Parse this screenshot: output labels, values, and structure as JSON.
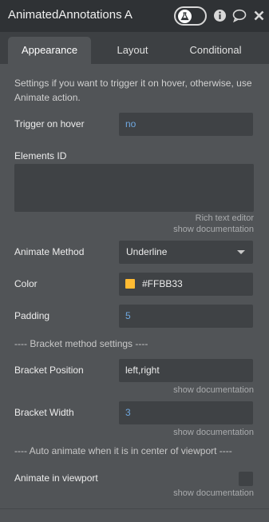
{
  "header": {
    "title": "AnimatedAnnotations A",
    "toggle_state": "off",
    "icons": [
      "flask-icon",
      "info-icon",
      "comment-icon",
      "close-icon"
    ]
  },
  "tabs": [
    {
      "label": "Appearance",
      "active": true
    },
    {
      "label": "Layout",
      "active": false
    },
    {
      "label": "Conditional",
      "active": false
    }
  ],
  "appearance": {
    "description": "Settings if you want to trigger it on hover, otherwise, use Animate action.",
    "trigger_on_hover": {
      "label": "Trigger on hover",
      "value": "no"
    },
    "elements_id": {
      "label": "Elements ID",
      "value": "",
      "hint": "Rich text editor",
      "doc_link": "show documentation"
    },
    "animate_method": {
      "label": "Animate Method",
      "value": "Underline"
    },
    "color": {
      "label": "Color",
      "value": "#FFBB33",
      "swatch": "#FFBB33"
    },
    "padding": {
      "label": "Padding",
      "value": "5"
    },
    "bracket_section": "---- Bracket method settings ----",
    "bracket_position": {
      "label": "Bracket Position",
      "value": "left,right",
      "doc_link": "show documentation"
    },
    "bracket_width": {
      "label": "Bracket Width",
      "value": "3",
      "doc_link": "show documentation"
    },
    "auto_section": "---- Auto animate when it is in center of viewport ----",
    "animate_in_viewport": {
      "label": "Animate in viewport",
      "checked": false,
      "doc_link": "show documentation"
    }
  },
  "colors": {
    "panel_bg": "#515457",
    "header_bg": "#2f3235",
    "tabbar_bg": "#3d4043",
    "field_bg": "#3f4245",
    "value_blue": "#6fa8e0",
    "accent": "#FFBB33"
  }
}
